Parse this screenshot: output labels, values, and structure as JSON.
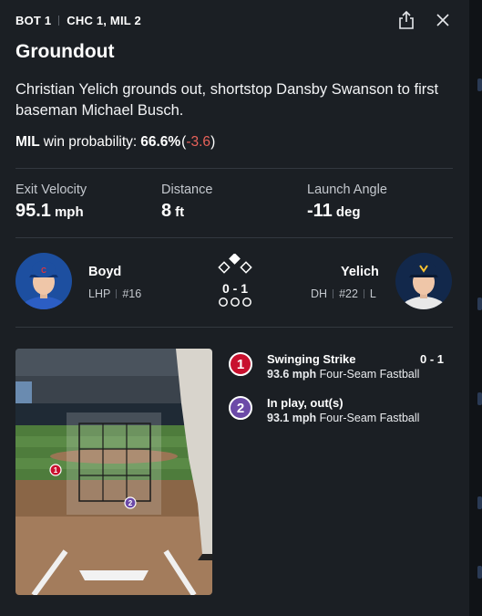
{
  "header": {
    "inning": "BOT 1",
    "score": "CHC 1, MIL 2"
  },
  "play": {
    "title": "Groundout",
    "description": "Christian Yelich grounds out, shortstop Dansby Swanson to first baseman Michael Busch."
  },
  "win_probability": {
    "team": "MIL",
    "label": "win probability:",
    "value": "66.6%",
    "change_open": "(",
    "change": "-3.6",
    "change_close": ")",
    "change_color": "#e8625a"
  },
  "stats": [
    {
      "label": "Exit Velocity",
      "value": "95.1",
      "unit": "mph"
    },
    {
      "label": "Distance",
      "value": "8",
      "unit": "ft"
    },
    {
      "label": "Launch Angle",
      "value": "-11",
      "unit": "deg"
    }
  ],
  "pitcher": {
    "name": "Boyd",
    "position": "LHP",
    "number": "#16",
    "team_logo": "C",
    "team_color": "#1d4fa0"
  },
  "batter": {
    "name": "Yelich",
    "position": "DH",
    "number": "#22",
    "bats": "L",
    "team_color": "#12284b"
  },
  "game_state": {
    "count": "0 - 1",
    "bases": {
      "first": false,
      "second": true,
      "third": false
    },
    "outs": 0
  },
  "pitches": [
    {
      "num": "1",
      "result": "Swinging Strike",
      "count": "0 - 1",
      "speed": "93.6 mph",
      "type": "Four-Seam Fastball",
      "color": "#c8102e"
    },
    {
      "num": "2",
      "result": "In play, out(s)",
      "count": "",
      "speed": "93.1 mph",
      "type": "Four-Seam Fastball",
      "color": "#6c4aa8"
    }
  ],
  "icons": {
    "share": "share-icon",
    "close": "close-icon"
  }
}
